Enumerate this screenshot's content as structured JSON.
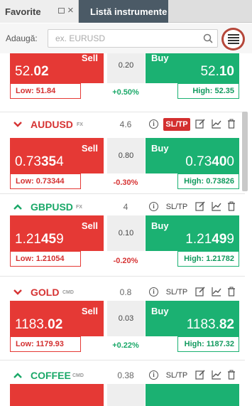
{
  "tabs": {
    "favorites_label": "Favorite",
    "instruments_label": "Listă instrumente",
    "close_glyph": "×"
  },
  "toolbar": {
    "add_label": "Adaugă:",
    "search_placeholder": "ex. EURUSD",
    "search_value": ""
  },
  "labels": {
    "sell": "Sell",
    "buy": "Buy",
    "sltp": "SL/TP",
    "info_glyph": "i"
  },
  "instruments": [
    {
      "symbol": "",
      "category": "",
      "direction": "",
      "sell": {
        "main": "52.",
        "big": "02",
        "tail": ""
      },
      "buy": {
        "main": "52.",
        "big": "10",
        "tail": ""
      },
      "spread": "0.20",
      "low": "Low: 51.84",
      "high": "High: 52.35",
      "change": "+0.50%"
    },
    {
      "symbol": "AUDUSD",
      "category": "FX",
      "direction": "down",
      "spread_head": "4.6",
      "sltp_active": true,
      "sell": {
        "main": "0.73",
        "big": "35",
        "tail": "4"
      },
      "buy": {
        "main": "0.73",
        "big": "40",
        "tail": "0"
      },
      "spread": "0.80",
      "low": "Low: 0.73344",
      "high": "High: 0.73826",
      "change": "-0.30%"
    },
    {
      "symbol": "GBPUSD",
      "category": "FX",
      "direction": "up",
      "spread_head": "4",
      "sltp_active": false,
      "sell": {
        "main": "1.21",
        "big": "45",
        "tail": "9"
      },
      "buy": {
        "main": "1.21",
        "big": "49",
        "tail": "9"
      },
      "spread": "0.10",
      "low": "Low: 1.21054",
      "high": "High: 1.21782",
      "change": "-0.20%"
    },
    {
      "symbol": "GOLD",
      "category": "CMD",
      "direction": "down",
      "spread_head": "0.8",
      "sltp_active": false,
      "sell": {
        "main": "1183.",
        "big": "02",
        "tail": ""
      },
      "buy": {
        "main": "1183.",
        "big": "82",
        "tail": ""
      },
      "spread": "0.03",
      "low": "Low: 1179.93",
      "high": "High: 1187.32",
      "change": "+0.22%"
    },
    {
      "symbol": "COFFEE",
      "category": "CMD",
      "direction": "up",
      "spread_head": "0.38",
      "sltp_active": false
    }
  ],
  "colors": {
    "sell": "#e53935",
    "buy": "#1bb172",
    "tab_active": "#4b5a66",
    "menu_ring": "#b5473a"
  }
}
